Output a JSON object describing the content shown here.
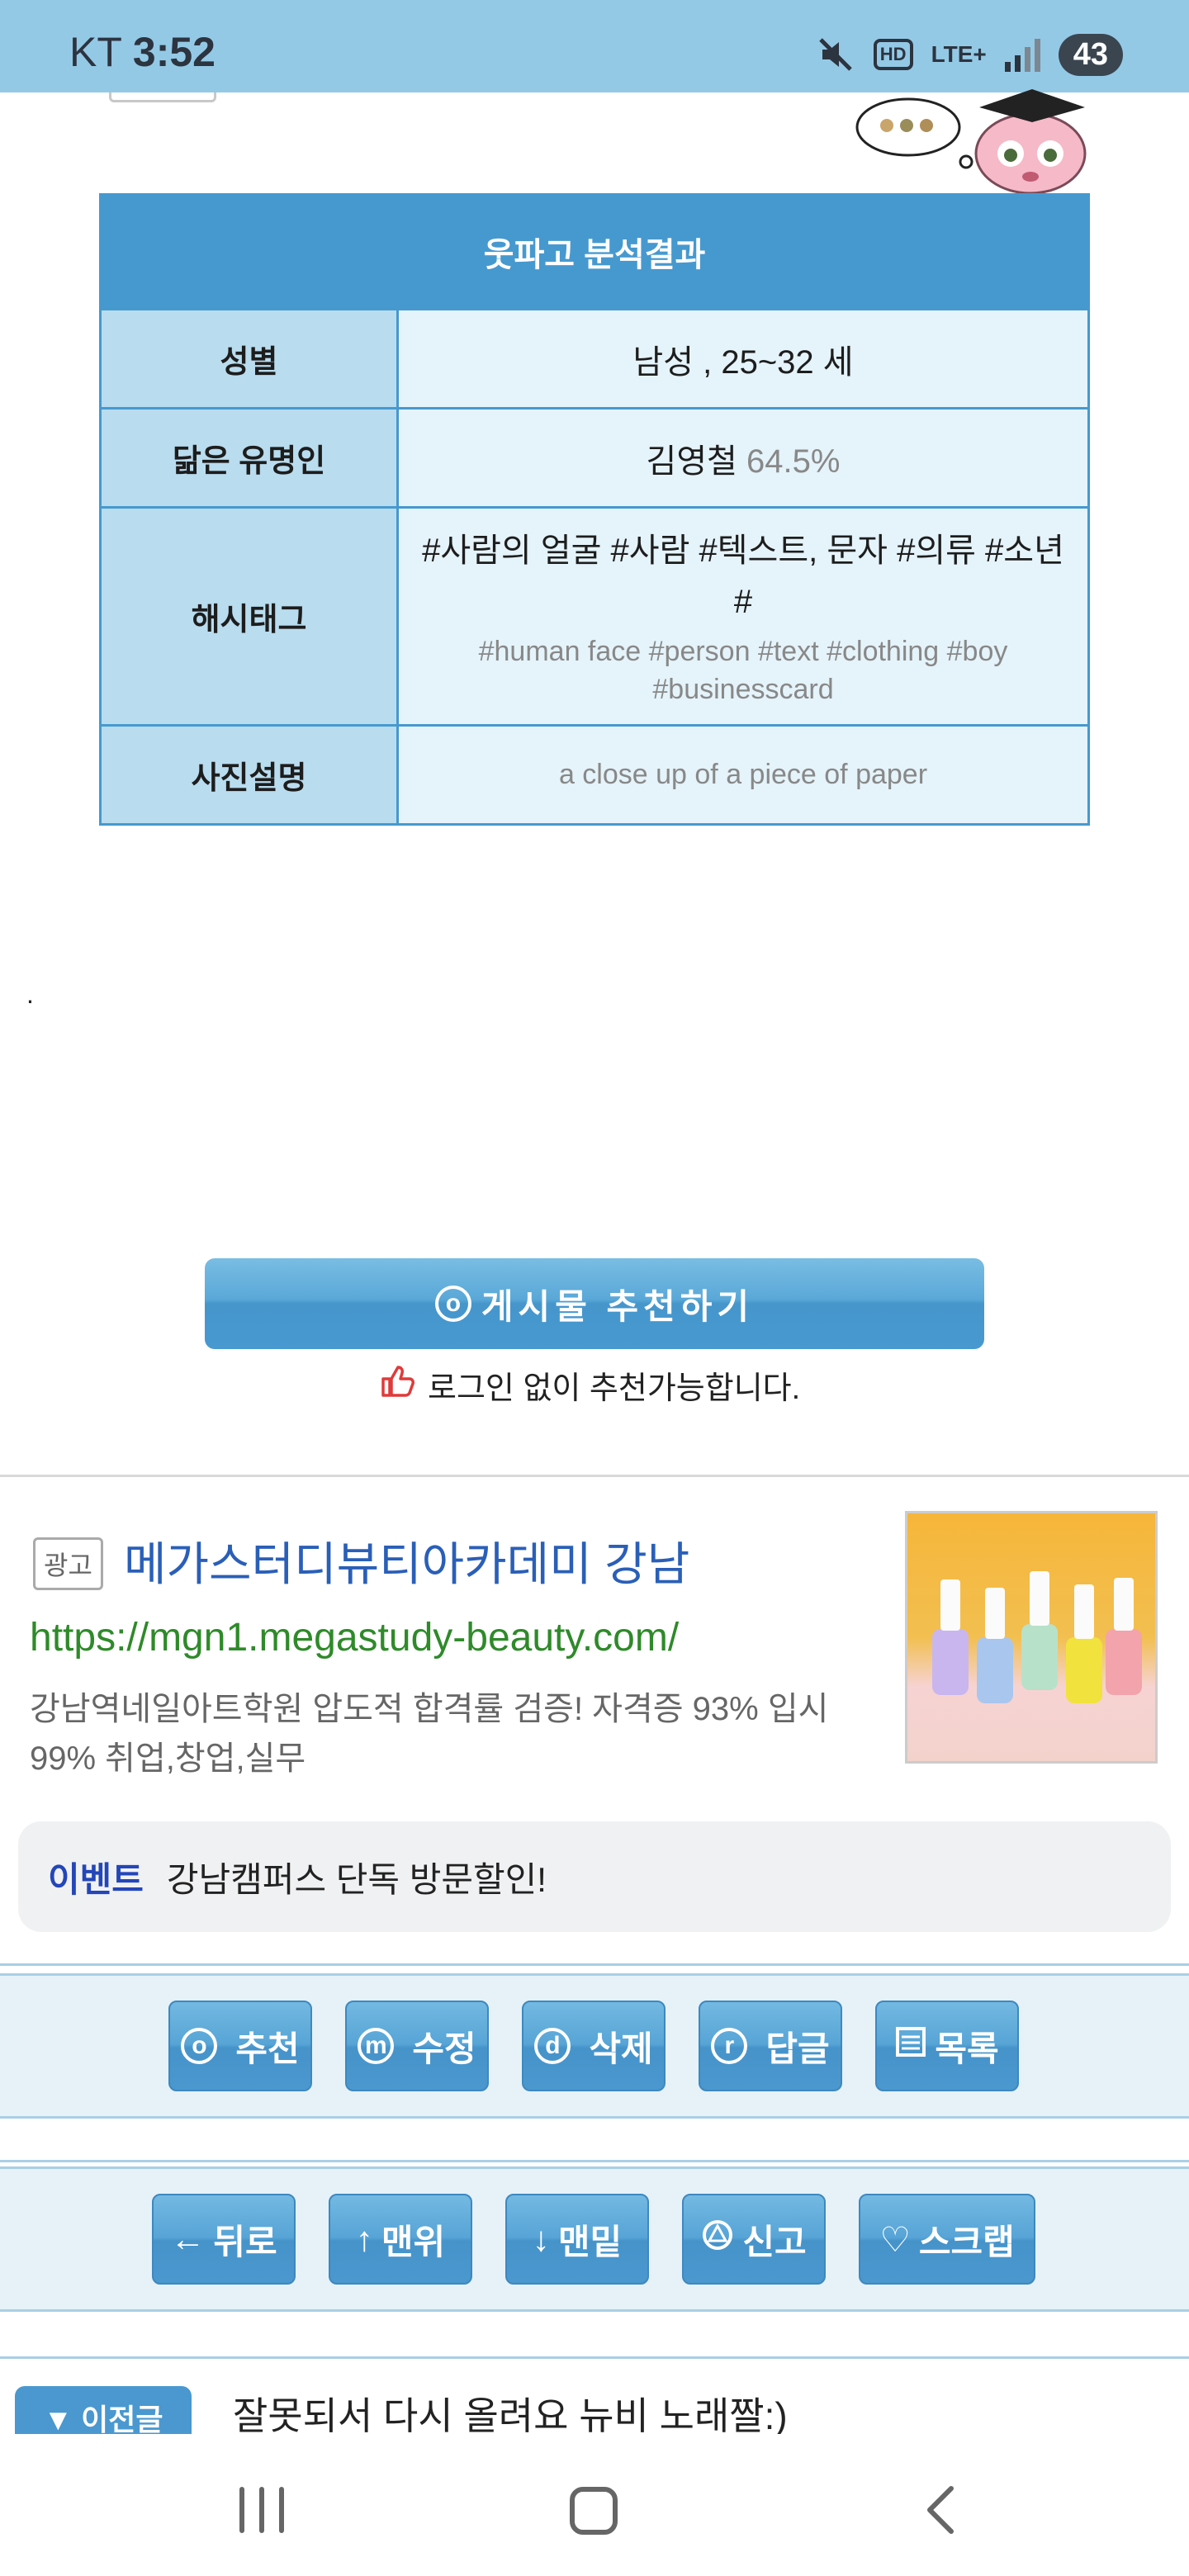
{
  "status_bar": {
    "carrier": "KT",
    "time": "3:52",
    "hd": "HD",
    "network": "LTE+",
    "battery": "43"
  },
  "analysis": {
    "title": "웃파고 분석결과",
    "rows": [
      {
        "label": "성별",
        "value": "남성 ,  25~32 세"
      },
      {
        "label": "닮은 유명인",
        "value": "김영철",
        "value_extra": "64.5%"
      },
      {
        "label": "해시태그",
        "value": "#사람의 얼굴 #사람 #텍스트, 문자 #의류 #소년 #",
        "value_extra": "#human face #person #text #clothing #boy #businesscard"
      },
      {
        "label": "사진설명",
        "value": "a close up of a piece of paper"
      }
    ]
  },
  "stray_dot": ".",
  "recommend": {
    "icon_letter": "o",
    "button_label": "게시물  추천하기",
    "note": "로그인 없이 추천가능합니다."
  },
  "ad": {
    "badge": "광고",
    "title": "메가스터디뷰티아카데미 강남",
    "url": "https://mgn1.megastudy-beauty.com/",
    "description": "강남역네일아트학원 압도적 합격률 검증! 자격증 93% 입시 99% 취업,창업,실무",
    "event_tag": "이벤트",
    "event_text": "강남캠퍼스 단독 방문할인!"
  },
  "actions_row1": [
    {
      "icon": "o",
      "label": "추천"
    },
    {
      "icon": "m",
      "label": "수정"
    },
    {
      "icon": "d",
      "label": "삭제"
    },
    {
      "icon": "r",
      "label": "답글"
    },
    {
      "icon": "list-icon",
      "label": "목록"
    }
  ],
  "actions_row2": [
    {
      "icon": "←",
      "label": "뒤로"
    },
    {
      "icon": "↑",
      "label": "맨위"
    },
    {
      "icon": "↓",
      "label": "맨밑"
    },
    {
      "icon": "alert-icon",
      "label": "신고"
    },
    {
      "icon": "♡",
      "label": "스크랩"
    }
  ],
  "next_post": {
    "tab_label": "▼ 이전글",
    "title": "잘못되서 다시 올려요 뉴비 노래짤:)"
  },
  "colors": {
    "status_bar": "#94c9e6",
    "table_header": "#4699cf",
    "table_key_bg": "#b9dcef",
    "table_value_bg": "#e5f3fa",
    "ad_title": "#2a5fb8",
    "ad_url": "#2f8a2a",
    "event_tag": "#2346b8"
  }
}
